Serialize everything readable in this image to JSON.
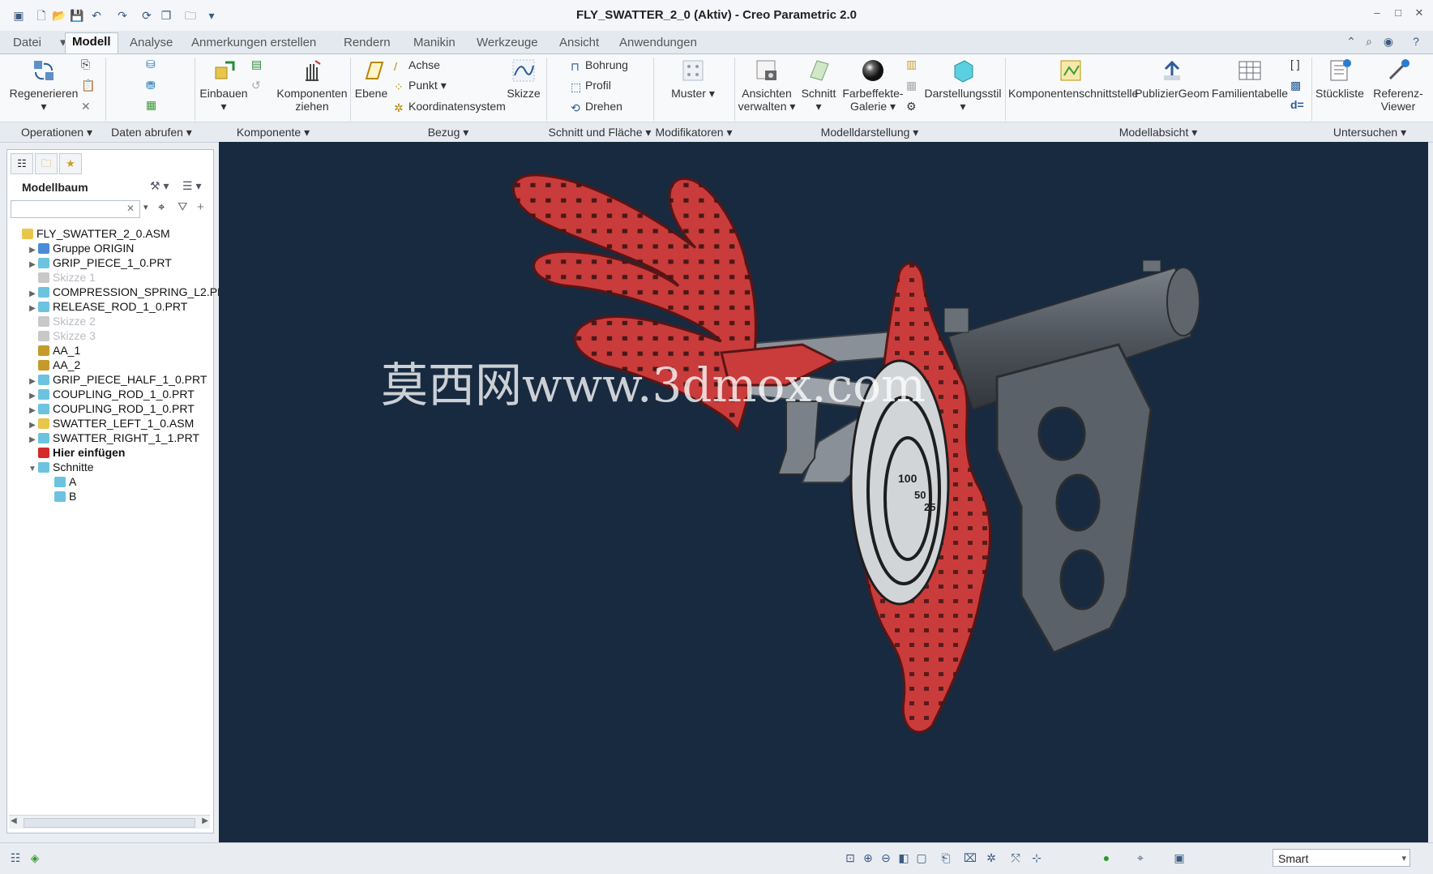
{
  "window": {
    "title": "FLY_SWATTER_2_0 (Aktiv) - Creo Parametric 2.0"
  },
  "tabs": [
    {
      "label": "Datei"
    },
    {
      "label": "Modell"
    },
    {
      "label": "Analyse"
    },
    {
      "label": "Anmerkungen erstellen"
    },
    {
      "label": "Rendern"
    },
    {
      "label": "Manikin"
    },
    {
      "label": "Werkzeuge"
    },
    {
      "label": "Ansicht"
    },
    {
      "label": "Anwendungen"
    }
  ],
  "ribbon": {
    "regenerieren": "Regenerieren",
    "einbauen": "Einbauen",
    "komponenten_ziehen_1": "Komponenten",
    "komponenten_ziehen_2": "ziehen",
    "ebene": "Ebene",
    "achse": "Achse",
    "punkt": "Punkt",
    "koordinatensystem": "Koordinatensystem",
    "skizze": "Skizze",
    "bohrung": "Bohrung",
    "profil": "Profil",
    "drehen": "Drehen",
    "muster": "Muster",
    "ansichten_1": "Ansichten",
    "ansichten_2": "verwalten",
    "schnitt": "Schnitt",
    "farbeffekte_1": "Farbeffekte-",
    "farbeffekte_2": "Galerie",
    "darstellungsstil": "Darstellungsstil",
    "komponentenschnittstelle": "Komponentenschnittstelle",
    "publiziergeom": "PublizierGeom",
    "familientabelle": "Familientabelle",
    "stueckliste": "Stückliste",
    "referenz_1": "Referenz-",
    "referenz_2": "Viewer"
  },
  "groups": [
    {
      "label": "Operationen"
    },
    {
      "label": "Daten abrufen"
    },
    {
      "label": "Komponente"
    },
    {
      "label": "Bezug"
    },
    {
      "label": "Schnitt und Fläche"
    },
    {
      "label": "Modifikatoren"
    },
    {
      "label": "Modelldarstellung"
    },
    {
      "label": "Modellabsicht"
    },
    {
      "label": "Untersuchen"
    }
  ],
  "panel": {
    "title": "Modellbaum"
  },
  "tree": [
    {
      "label": "FLY_SWATTER_2_0.ASM",
      "indent": 0,
      "expander": "",
      "icon": "assembly-icon",
      "color": "#e8c64a",
      "muted": false
    },
    {
      "label": "Gruppe ORIGIN",
      "indent": 1,
      "expander": "▶",
      "icon": "group-icon",
      "color": "#4b8ad6",
      "muted": false
    },
    {
      "label": "GRIP_PIECE_1_0.PRT",
      "indent": 1,
      "expander": "▶",
      "icon": "part-icon",
      "color": "#6cc3e0",
      "muted": false
    },
    {
      "label": "Skizze 1",
      "indent": 1,
      "expander": "",
      "icon": "sketch-icon",
      "color": "#c8c8c8",
      "muted": true
    },
    {
      "label": "COMPRESSION_SPRING_L2.PRT",
      "indent": 1,
      "expander": "▶",
      "icon": "part-icon",
      "color": "#6cc3e0",
      "muted": false
    },
    {
      "label": "RELEASE_ROD_1_0.PRT",
      "indent": 1,
      "expander": "▶",
      "icon": "part-icon",
      "color": "#6cc3e0",
      "muted": false
    },
    {
      "label": "Skizze 2",
      "indent": 1,
      "expander": "",
      "icon": "sketch-icon",
      "color": "#c8c8c8",
      "muted": true
    },
    {
      "label": "Skizze 3",
      "indent": 1,
      "expander": "",
      "icon": "sketch-icon",
      "color": "#c8c8c8",
      "muted": true
    },
    {
      "label": "AA_1",
      "indent": 1,
      "expander": "",
      "icon": "axis-icon",
      "color": "#c59a2a",
      "muted": false
    },
    {
      "label": "AA_2",
      "indent": 1,
      "expander": "",
      "icon": "axis-icon",
      "color": "#c59a2a",
      "muted": false
    },
    {
      "label": "GRIP_PIECE_HALF_1_0.PRT",
      "indent": 1,
      "expander": "▶",
      "icon": "part-icon",
      "color": "#6cc3e0",
      "muted": false
    },
    {
      "label": "COUPLING_ROD_1_0.PRT",
      "indent": 1,
      "expander": "▶",
      "icon": "part-icon",
      "color": "#6cc3e0",
      "muted": false
    },
    {
      "label": "COUPLING_ROD_1_0.PRT",
      "indent": 1,
      "expander": "▶",
      "icon": "part-icon",
      "color": "#6cc3e0",
      "muted": false
    },
    {
      "label": "SWATTER_LEFT_1_0.ASM",
      "indent": 1,
      "expander": "▶",
      "icon": "assembly-icon",
      "color": "#e8c64a",
      "muted": false
    },
    {
      "label": "SWATTER_RIGHT_1_1.PRT",
      "indent": 1,
      "expander": "▶",
      "icon": "part-icon",
      "color": "#6cc3e0",
      "muted": false
    },
    {
      "label": "Hier einfügen",
      "indent": 1,
      "expander": "",
      "icon": "insert-here-icon",
      "color": "#d42a2a",
      "muted": false
    },
    {
      "label": "Schnitte",
      "indent": 1,
      "expander": "▼",
      "icon": "sections-icon",
      "color": "#6cc3e0",
      "muted": false
    },
    {
      "label": "A",
      "indent": 2,
      "expander": "",
      "icon": "section-icon",
      "color": "#6cc3e0",
      "muted": false
    },
    {
      "label": "B",
      "indent": 2,
      "expander": "",
      "icon": "section-icon",
      "color": "#6cc3e0",
      "muted": false
    }
  ],
  "watermark": "莫西网www.3dmox.com",
  "target_labels": [
    "100",
    "50",
    "25"
  ],
  "status": {
    "selection_filter": "Smart"
  },
  "colors": {
    "viewport_bg": "#172a40",
    "swatter_red": "#c93c3b",
    "grip_gray": "#5b6169"
  }
}
